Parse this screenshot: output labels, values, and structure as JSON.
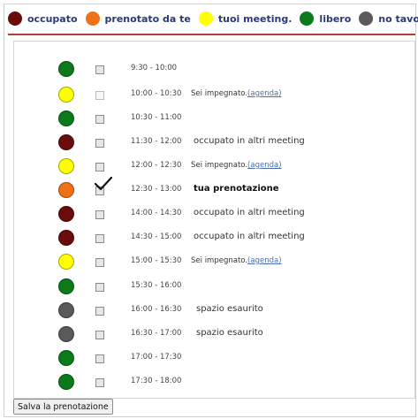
{
  "colors": {
    "occupato": "#6b0c0c",
    "prenotato": "#f07018",
    "tuoi": "#ffff00",
    "libero": "#0b7a1a",
    "no_tavoli": "#5a5a5a",
    "divider": "#b83a3a"
  },
  "legend": [
    {
      "label": "occupato",
      "color": "#6b0c0c"
    },
    {
      "label": "prenotato da te",
      "color": "#f07018"
    },
    {
      "label": "tuoi meeting.",
      "color": "#ffff00"
    },
    {
      "label": "libero",
      "color": "#0b7a1a"
    },
    {
      "label": "no tavoli",
      "color": "#5a5a5a"
    }
  ],
  "slots": [
    {
      "time": "9:30 - 10:00",
      "color": "#0b7a1a"
    },
    {
      "time": "10:00 - 10:30",
      "color": "#ffff00",
      "status": "Sei impegnato.",
      "link": "(agenda)"
    },
    {
      "time": "10:30 - 11:00",
      "color": "#0b7a1a"
    },
    {
      "time": "11:30 - 12:00",
      "color": "#6b0c0c",
      "status": "occupato in altri meeting"
    },
    {
      "time": "12:00 - 12:30",
      "color": "#ffff00",
      "status": "Sei impegnato.",
      "link": "(agenda)"
    },
    {
      "time": "12:30 - 13:00",
      "color": "#f07018",
      "status": "tua prenotazione",
      "checked": true
    },
    {
      "time": "14:00 - 14:30",
      "color": "#6b0c0c",
      "status": "occupato in altri meeting"
    },
    {
      "time": "14:30 - 15:00",
      "color": "#6b0c0c",
      "status": "occupato in altri meeting"
    },
    {
      "time": "15:00 - 15:30",
      "color": "#ffff00",
      "status": "Sei impegnato.",
      "link": "(agenda)"
    },
    {
      "time": "15:30 - 16:00",
      "color": "#0b7a1a"
    },
    {
      "time": "16:00 - 16:30",
      "color": "#5a5a5a",
      "status": "spazio esaurito"
    },
    {
      "time": "16:30 - 17:00",
      "color": "#5a5a5a",
      "status": "spazio esaurito"
    },
    {
      "time": "17:00 - 17:30",
      "color": "#0b7a1a"
    },
    {
      "time": "17:30 - 18:00",
      "color": "#0b7a1a"
    }
  ],
  "save_button": "Salva la prenotazione"
}
